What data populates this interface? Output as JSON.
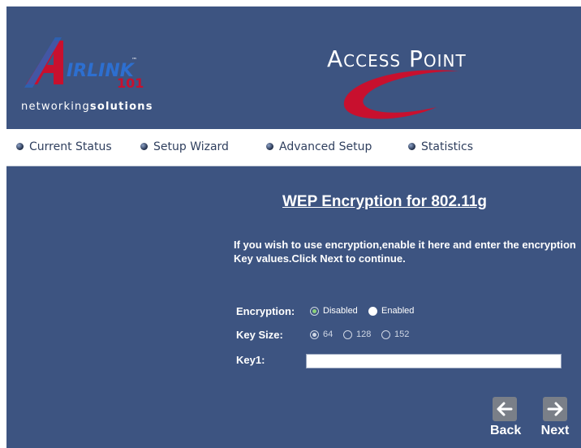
{
  "header": {
    "brand_name": "AIRLINK",
    "brand_number": "101",
    "brand_tm": "™",
    "tagline_regular": "networking",
    "tagline_bold": "solutions",
    "product_title": "Access Point",
    "colors": {
      "background": "#3d5481",
      "swoosh": "#c8102e",
      "nav_bg": "#ffffff"
    }
  },
  "nav": {
    "items": [
      {
        "label": "Current Status"
      },
      {
        "label": "Setup Wizard"
      },
      {
        "label": "Advanced Setup"
      },
      {
        "label": "Statistics"
      }
    ]
  },
  "main": {
    "title": "WEP Encryption for 802.11g",
    "intro": "If you wish to use encryption,enable it here and enter the encryption Key values.Click Next to continue.",
    "encryption": {
      "label": "Encryption:",
      "options": [
        {
          "label": "Disabled",
          "selected": true
        },
        {
          "label": "Enabled",
          "selected": false
        }
      ]
    },
    "key_size": {
      "label": "Key Size:",
      "options": [
        {
          "label": "64",
          "selected": true
        },
        {
          "label": "128",
          "selected": false
        },
        {
          "label": "152",
          "selected": false
        }
      ]
    },
    "key1": {
      "label": "Key1:",
      "value": "",
      "placeholder": ""
    }
  },
  "buttons": {
    "back_label": "Back",
    "next_label": "Next",
    "back_icon": "arrow-left-icon",
    "next_icon": "arrow-right-icon"
  }
}
